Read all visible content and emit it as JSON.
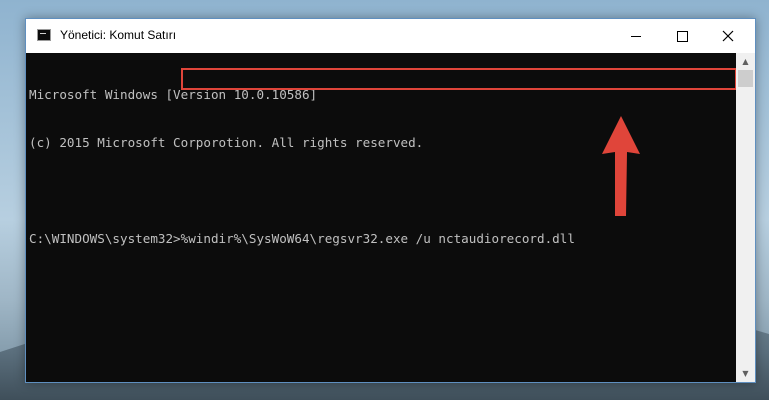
{
  "window": {
    "title": "Yönetici: Komut Satırı"
  },
  "console": {
    "lines": [
      "Microsoft Windows [Version 10.0.10586]",
      "(c) 2015 Microsoft Corporotion. All rights reserved.",
      "",
      "C:\\WINDOWS\\system32>%windir%\\SysWoW64\\regsvr32.exe /u nctaudiorecord.dll"
    ]
  },
  "colors": {
    "highlight": "#e0453a",
    "console_bg": "#0c0c0c",
    "console_text": "#c0c0c0"
  },
  "icons": {
    "app": "cmd-icon",
    "minimize": "minimize-icon",
    "maximize": "maximize-icon",
    "close": "close-icon"
  }
}
